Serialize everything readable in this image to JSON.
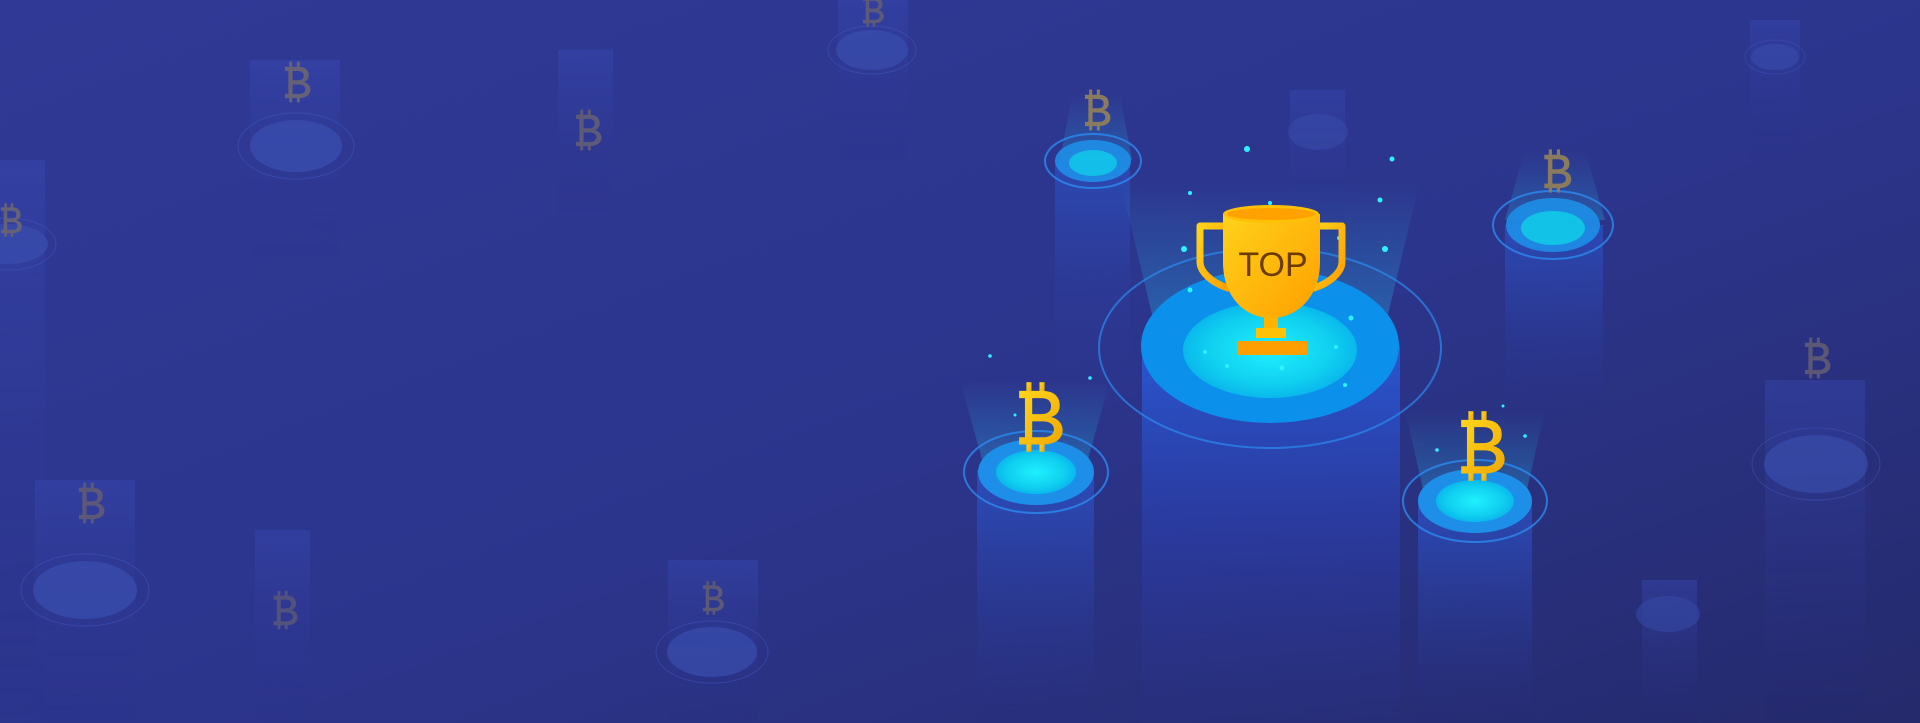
{
  "banner": {
    "trophy_label": "TOP"
  },
  "palette": {
    "background_left": "#303a96",
    "background_right": "#262b6e",
    "gold": "#ffb800",
    "glow_cyan": "#13e0f0",
    "platform_blue": "#0c8ef0",
    "faded_coin": "#8a7a5e"
  },
  "icons": {
    "trophy": "trophy-icon",
    "coin": "bitcoin-icon"
  }
}
